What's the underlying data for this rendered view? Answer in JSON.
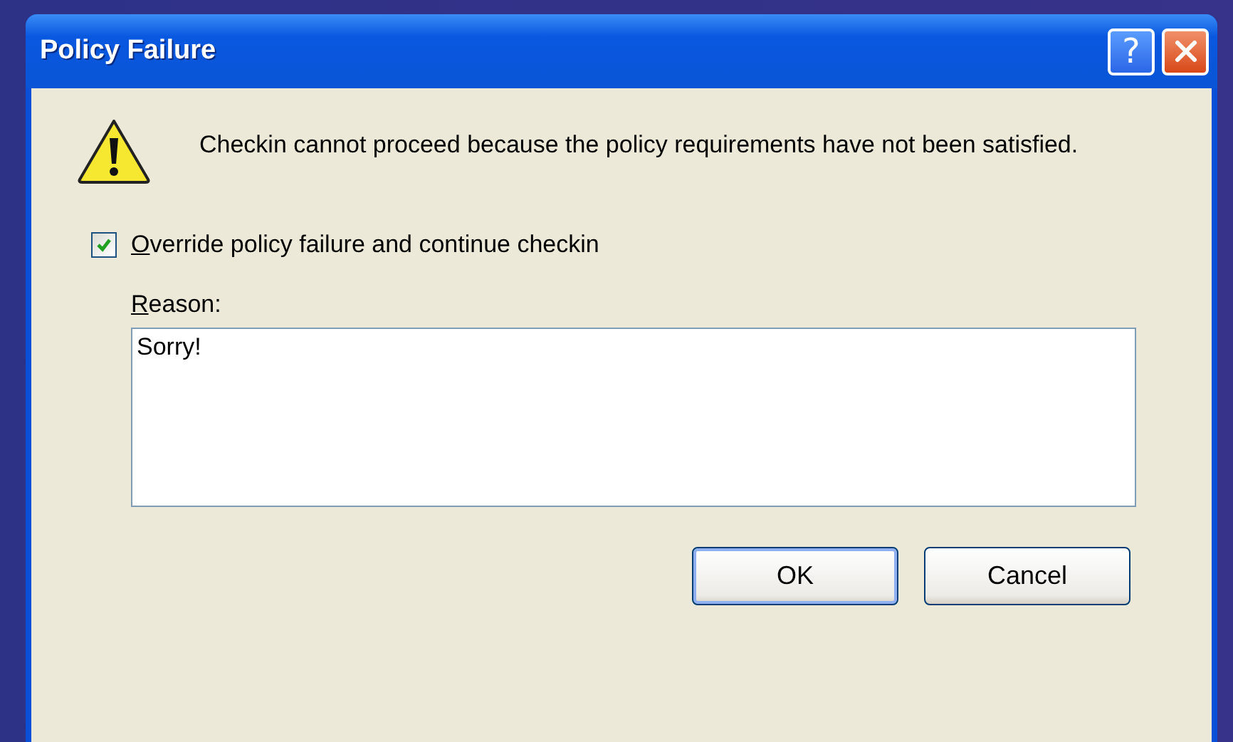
{
  "window": {
    "title": "Policy Failure",
    "title_buttons": [
      {
        "kind": "help",
        "label": "?"
      },
      {
        "kind": "close"
      }
    ]
  },
  "message": "Checkin cannot proceed because the policy requirements have not been satisfied.",
  "override": {
    "checked": true,
    "mnemonic": "O",
    "label_rest": "verride policy failure and continue checkin"
  },
  "reason": {
    "mnemonic": "R",
    "label_rest": "eason:",
    "value": "Sorry!"
  },
  "buttons": [
    {
      "label": "OK",
      "default": true
    },
    {
      "label": "Cancel",
      "default": false
    }
  ]
}
